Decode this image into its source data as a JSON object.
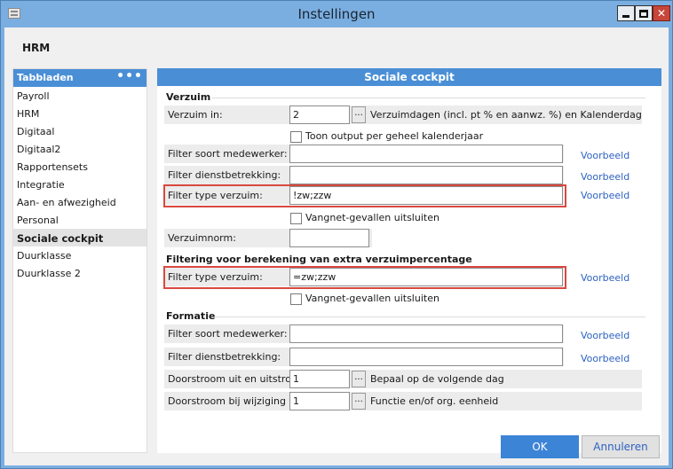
{
  "window": {
    "title": "Instellingen"
  },
  "module": "HRM",
  "sidebar": {
    "header": "Tabbladen",
    "more": "•••",
    "items": [
      {
        "label": "Payroll"
      },
      {
        "label": "HRM"
      },
      {
        "label": "Digitaal"
      },
      {
        "label": "Digitaal2"
      },
      {
        "label": "Rapportensets"
      },
      {
        "label": "Integratie"
      },
      {
        "label": "Aan- en afwezigheid"
      },
      {
        "label": "Personal"
      },
      {
        "label": "Sociale cockpit"
      },
      {
        "label": "Duurklasse"
      },
      {
        "label": "Duurklasse 2"
      }
    ],
    "active_index": 8
  },
  "panel": {
    "title": "Sociale cockpit",
    "verzuim": {
      "section": "Verzuim",
      "verzuim_in_label": "Verzuim in:",
      "verzuim_in_value": "2",
      "verzuim_in_button": "...",
      "verzuim_in_desc": "Verzuimdagen (incl. pt % en aanwz. %) en Kalenderdagen (incl",
      "toon_output_label": "Toon output per geheel kalenderjaar",
      "filter_soort_label": "Filter soort medewerker:",
      "filter_soort_value": "",
      "filter_soort_link": "Voorbeeld",
      "filter_dienst_label": "Filter dienstbetrekking:",
      "filter_dienst_value": "",
      "filter_dienst_link": "Voorbeeld",
      "filter_type_label": "Filter type verzuim:",
      "filter_type_value": "!zw;zzw",
      "filter_type_link": "Voorbeeld",
      "vangnet_label": "Vangnet-gevallen uitsluiten",
      "norm_label": "Verzuimnorm:",
      "norm_value": ""
    },
    "filtering": {
      "section": "Filtering voor berekening van extra verzuimpercentage",
      "filter_type_label": "Filter type verzuim:",
      "filter_type_value": "=zw;zzw",
      "filter_type_link": "Voorbeeld",
      "vangnet_label": "Vangnet-gevallen uitsluiten"
    },
    "formatie": {
      "section": "Formatie",
      "filter_soort_label": "Filter soort medewerker:",
      "filter_soort_value": "",
      "filter_soort_link": "Voorbeeld",
      "filter_dienst_label": "Filter dienstbetrekking:",
      "filter_dienst_value": "",
      "filter_dienst_link": "Voorbeeld",
      "doorstroom_label": "Doorstroom uit en uitstroom:",
      "doorstroom_value": "1",
      "doorstroom_button": "...",
      "doorstroom_desc": "Bepaal op de volgende dag",
      "doorstroom_wijz_label": "Doorstroom bij wijziging van:",
      "doorstroom_wijz_value": "1",
      "doorstroom_wijz_button": "...",
      "doorstroom_wijz_desc": "Functie en/of org. eenheid"
    }
  },
  "buttons": {
    "ok": "OK",
    "cancel": "Annuleren"
  },
  "colors": {
    "accent": "#4a8fd6",
    "highlight": "#d94841",
    "link": "#2d62c2"
  }
}
